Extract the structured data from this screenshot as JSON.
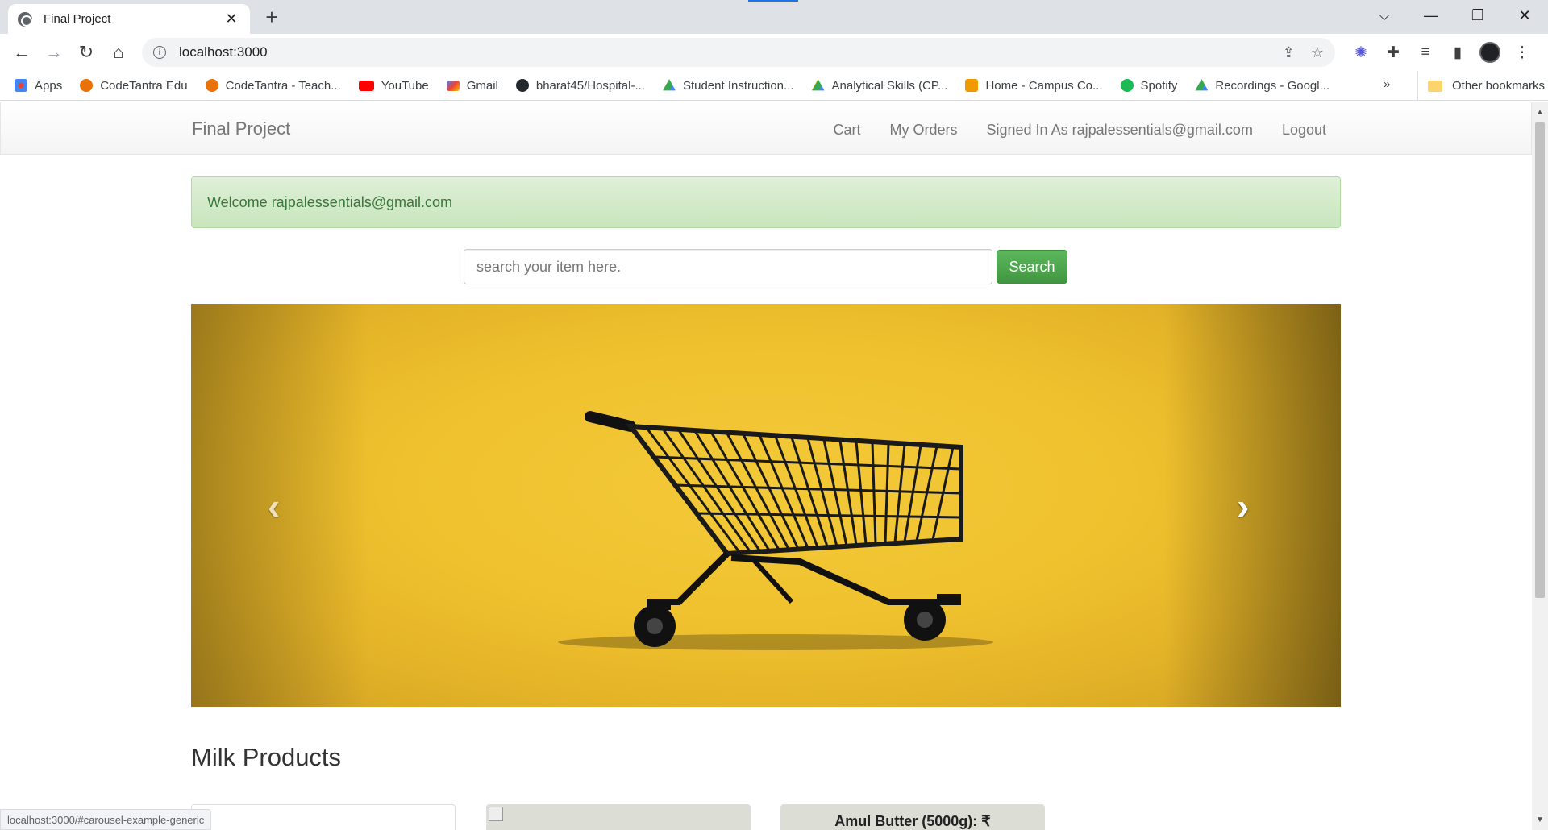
{
  "browser": {
    "tab_title": "Final Project",
    "tab_close": "✕",
    "new_tab": "+",
    "url": "localhost:3000",
    "window_controls": [
      "⌵",
      "—",
      "❐",
      "✕"
    ],
    "bookmarks": [
      {
        "label": "Apps",
        "icon": "apps-grid-icon",
        "color": "#4285f4"
      },
      {
        "label": "CodeTantra Edu",
        "icon": "codetantra-icon",
        "color": "#e8710a"
      },
      {
        "label": "CodeTantra - Teach...",
        "icon": "codetantra-icon",
        "color": "#e8710a"
      },
      {
        "label": "YouTube",
        "icon": "youtube-icon",
        "color": "#ff0000"
      },
      {
        "label": "Gmail",
        "icon": "gmail-icon",
        "color": "#ea4335"
      },
      {
        "label": "bharat45/Hospital-...",
        "icon": "github-icon",
        "color": "#24292e"
      },
      {
        "label": "Student Instruction...",
        "icon": "google-drive-icon",
        "color": "#34a853"
      },
      {
        "label": "Analytical Skills (CP...",
        "icon": "google-drive-icon",
        "color": "#34a853"
      },
      {
        "label": "Home - Campus Co...",
        "icon": "campus-icon",
        "color": "#f29900"
      },
      {
        "label": "Spotify",
        "icon": "spotify-icon",
        "color": "#1db954"
      },
      {
        "label": "Recordings - Googl...",
        "icon": "google-drive-icon",
        "color": "#34a853"
      }
    ],
    "bookmarks_more": "»",
    "other_bookmarks": "Other bookmarks",
    "status_url": "localhost:3000/#carousel-example-generic"
  },
  "page": {
    "brand": "Final Project",
    "nav": {
      "cart": "Cart",
      "orders": "My Orders",
      "signed_in": "Signed In As rajpalessentials@gmail.com",
      "logout": "Logout"
    },
    "alert": "Welcome rajpalessentials@gmail.com",
    "search": {
      "placeholder": "search your item here.",
      "button": "Search"
    },
    "carousel": {
      "prev": "‹",
      "next": "›"
    },
    "section_title": "Milk Products",
    "cards": [
      {
        "title": ""
      },
      {
        "title": ""
      },
      {
        "title": "Amul Butter (5000g): ₹"
      }
    ]
  },
  "colors": {
    "alert_bg": "#dff0d8",
    "alert_text": "#3c763d",
    "search_button": "#5cb85c",
    "carousel_bg": "#efc12e"
  }
}
